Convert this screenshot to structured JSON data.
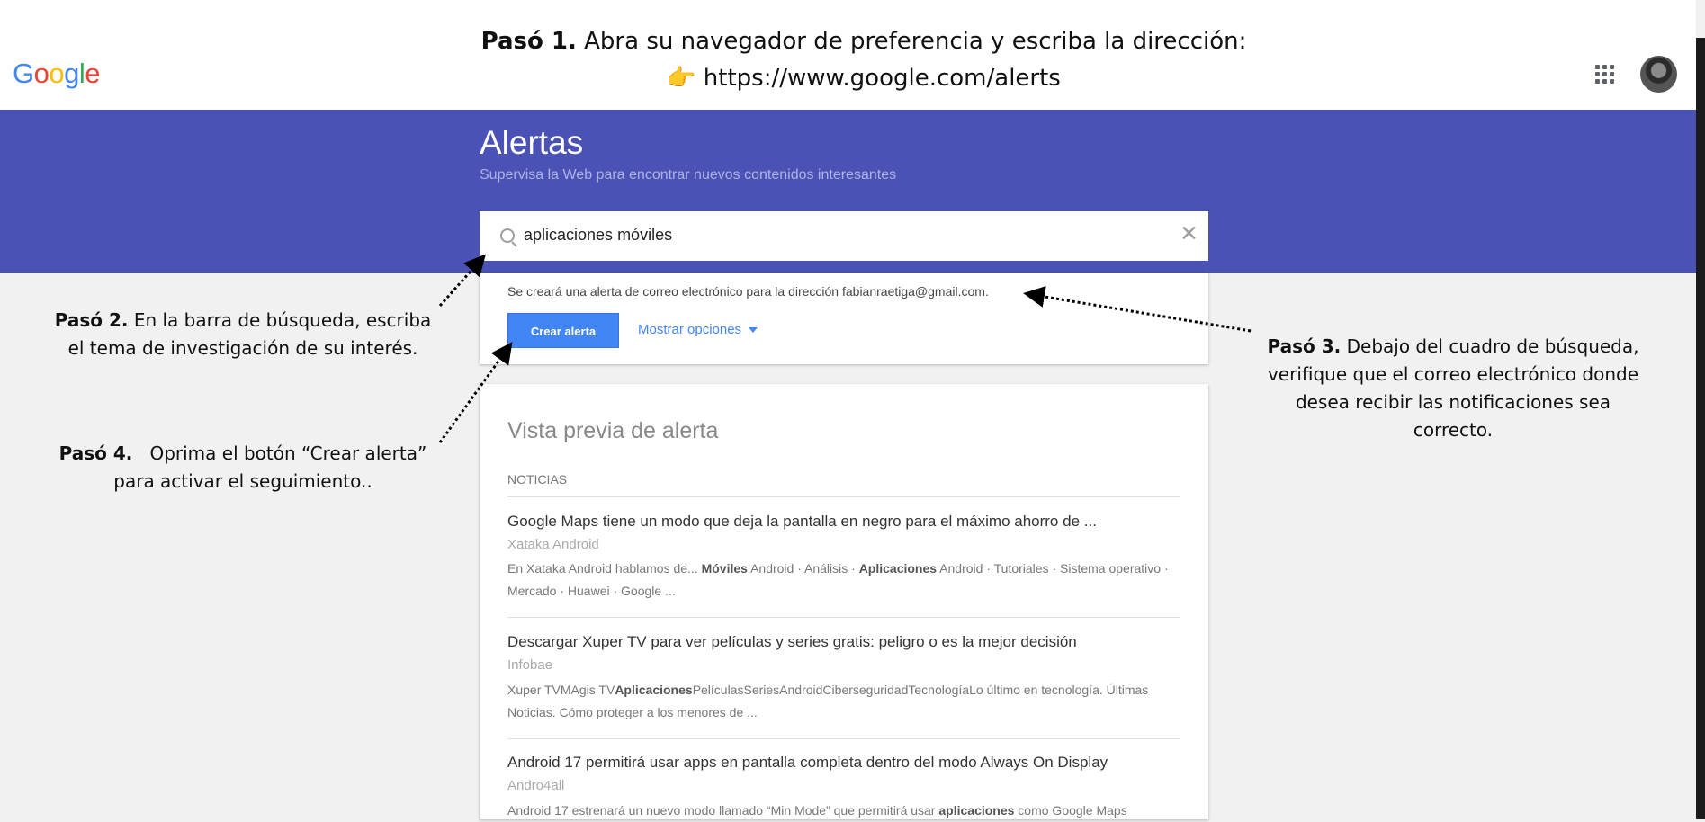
{
  "google_logo": [
    "G",
    "o",
    "o",
    "g",
    "l",
    "e"
  ],
  "logo_colors": [
    "#4285f4",
    "#ea4335",
    "#fbbc05",
    "#4285f4",
    "#34a853",
    "#ea4335"
  ],
  "step1": {
    "bold": "Pasó 1.",
    "text": "Abra su navegador de preferencia y escriba la dirección:",
    "pointer": "👉",
    "url": "https://www.google.com/alerts"
  },
  "header": {
    "title": "Alertas",
    "subtitle": "Supervisa la Web para encontrar nuevos contenidos interesantes"
  },
  "search": {
    "value": "aplicaciones móviles",
    "clear": "✕"
  },
  "alert_form": {
    "email_note": "Se creará una alerta de correo electrónico para la dirección fabianraetiga@gmail.com.",
    "create_button": "Crear alerta",
    "show_options": "Mostrar opciones"
  },
  "preview": {
    "title": "Vista previa de alerta",
    "section": "NOTICIAS",
    "articles": [
      {
        "title": "Google Maps tiene un modo que deja la pantalla en negro para el máximo ahorro de ...",
        "source": "Xataka Android",
        "snippet": [
          {
            "t": "En Xataka Android hablamos de... ",
            "b": false
          },
          {
            "t": "Móviles",
            "b": true
          },
          {
            "t": " Android · Análisis · ",
            "b": false
          },
          {
            "t": "Aplicaciones",
            "b": true
          },
          {
            "t": " Android · Tutoriales · Sistema operativo · Mercado · Huawei · Google ...",
            "b": false
          }
        ]
      },
      {
        "title": "Descargar Xuper TV para ver películas y series gratis: peligro o es la mejor decisión",
        "source": "Infobae",
        "snippet": [
          {
            "t": "Xuper TVMAgis TV",
            "b": false
          },
          {
            "t": "Aplicaciones",
            "b": true
          },
          {
            "t": "PelículasSeriesAndroidCiberseguridadTecnologíaLo último en tecnología. Últimas Noticias. Cómo proteger a los menores de ...",
            "b": false
          }
        ]
      },
      {
        "title": "Android 17 permitirá usar apps en pantalla completa dentro del modo Always On Display",
        "source": "Andro4all",
        "snippet": [
          {
            "t": "Android 17 estrenará un nuevo modo llamado “Min Mode” que permitirá usar ",
            "b": false
          },
          {
            "t": "aplicaciones",
            "b": true
          },
          {
            "t": " como Google Maps",
            "b": false
          }
        ]
      }
    ]
  },
  "notes": {
    "step2": {
      "bold": "Pasó 2.",
      "line1": " En la barra de búsqueda, escriba",
      "line2": "el tema de investigación de su interés."
    },
    "step3": {
      "bold": "Pasó 3.",
      "line1": " Debajo del cuadro de búsqueda,",
      "line2": "verifique que el correo electrónico donde",
      "line3": "desea recibir las notificaciones sea",
      "line4": "correcto."
    },
    "step4": {
      "bold": "Pasó 4.",
      "line1": "   Oprima el botón “Crear alerta”",
      "line2": "para activar el seguimiento.."
    }
  }
}
